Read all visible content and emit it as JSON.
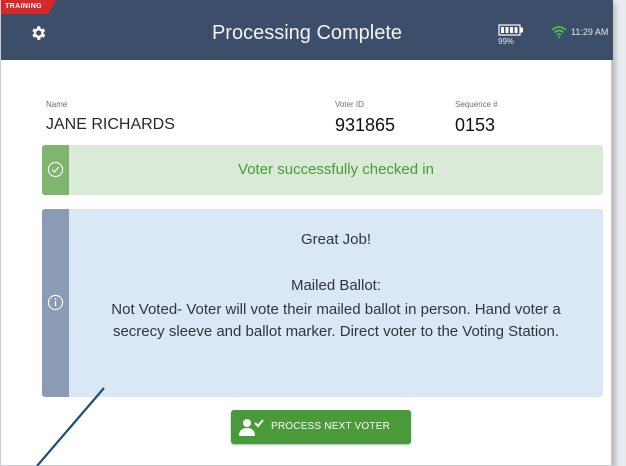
{
  "header": {
    "training_badge": "TRAINING",
    "title": "Processing Complete",
    "battery_percent": "99%",
    "time": "11:29 AM"
  },
  "voter": {
    "name_label": "Name",
    "name": "JANE RICHARDS",
    "voter_id_label": "Voter ID",
    "voter_id": "931865",
    "sequence_label": "Sequence #",
    "sequence": "0153"
  },
  "success_banner": {
    "message": "Voter successfully checked in",
    "icon": "check-circle-icon"
  },
  "info_panel": {
    "icon": "info-circle-icon",
    "heading": "Great Job!",
    "subheading": "Mailed Ballot:",
    "body": "Not Voted- Voter will vote their mailed ballot in person. Hand voter a secrecy sleeve and ballot marker. Direct voter to the Voting Station."
  },
  "actions": {
    "process_next": "PROCESS NEXT VOTER"
  },
  "colors": {
    "header_bg": "#3c4e6a",
    "success_bg": "#d9ead6",
    "success_accent": "#7fb56f",
    "success_text": "#4a9a3a",
    "info_bg": "#d9e8f4",
    "info_accent": "#8b9bb5",
    "button_bg": "#4a9a3a",
    "training_red": "#d62828"
  }
}
